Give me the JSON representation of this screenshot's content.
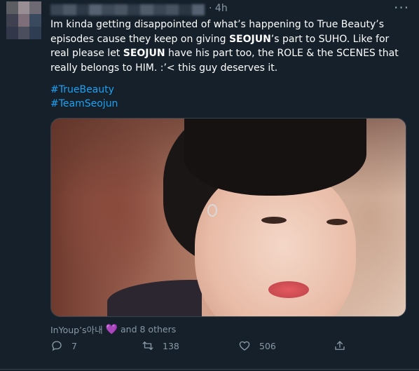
{
  "tweet": {
    "time": "4h",
    "text_parts": [
      {
        "t": "Im kinda getting disappointed of what’s happening to True Beauty’s episodes cause they keep on giving ",
        "b": false
      },
      {
        "t": "SEOJUN",
        "b": true
      },
      {
        "t": "’s part to SUHO. Like for real please let ",
        "b": false
      },
      {
        "t": "SEOJUN",
        "b": true
      },
      {
        "t": " have his part too, the ROLE & the SCENES that really belongs to HIM. :’< this guy deserves it.",
        "b": false
      }
    ],
    "hashtags": [
      "#TrueBeauty",
      "#TeamSeojun"
    ],
    "liked_by": "InYoup’s아내",
    "liked_by_heart": "💜",
    "liked_by_suffix": "and 8 others",
    "actions": {
      "replies": "7",
      "retweets": "138",
      "likes": "506"
    }
  },
  "icons": {
    "more": "more-icon",
    "reply": "reply-icon",
    "retweet": "retweet-icon",
    "like": "heart-icon",
    "share": "share-icon"
  },
  "colors": {
    "background": "#15202b",
    "link": "#1da1f2",
    "muted": "#8899a6",
    "heart": "#9b59d0"
  }
}
